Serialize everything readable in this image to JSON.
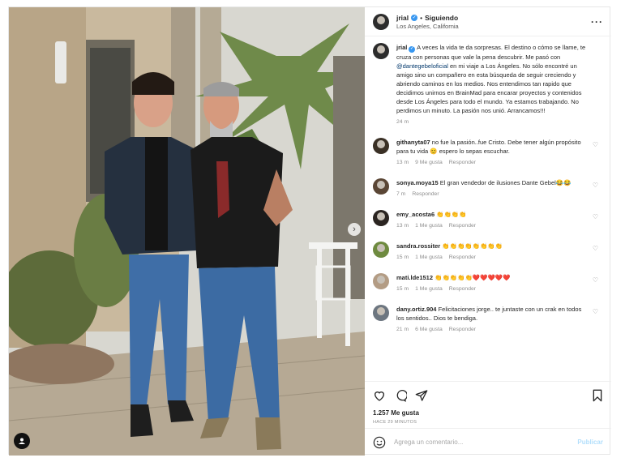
{
  "post": {
    "username": "jrial",
    "follow_label": "Siguiendo",
    "location": "Los Angeles, California",
    "caption_text": "A veces la vida te da sorpresas. El destino o cómo se llame, te cruza con personas que vale la pena descubrir. Me pasó con ",
    "caption_mention": "@dantegebeloficial",
    "caption_text2": " en mi viaje a Los Ángeles. No sólo encontré un amigo sino un compañero en esta búsqueda de seguir creciendo y abriendo caminos en los medios. Nos entendimos tan rapido que decidimos unirnos en BrainMad para encarar proyectos y contenidos desde Los Ángeles para todo el mundo. Ya estamos trabajando. No perdimos un minuto. La pasión nos unió. Arrancamos!!!",
    "caption_time": "24 m"
  },
  "comments": [
    {
      "user": "githanyta07",
      "text": "no fue la pasión..fue Cristo. Debe tener algún propósito para tu vida 😊 espero lo sepas escuchar.",
      "time": "13 m",
      "likes": "9 Me gusta",
      "reply": "Responder"
    },
    {
      "user": "sonya.moya15",
      "text": "El gran vendedor de ilusiones Dante Gebel😂😂",
      "time": "7 m",
      "likes": "",
      "reply": "Responder"
    },
    {
      "user": "emy_acosta6",
      "text": "👏👏👏👏",
      "time": "13 m",
      "likes": "1 Me gusta",
      "reply": "Responder"
    },
    {
      "user": "sandra.rossiter",
      "text": "👏👏👏👏👏👏👏👏",
      "time": "15 m",
      "likes": "1 Me gusta",
      "reply": "Responder"
    },
    {
      "user": "mati.lde1512",
      "text": "👏👏👏👏👏❤️❤️❤️❤️❤️",
      "time": "15 m",
      "likes": "1 Me gusta",
      "reply": "Responder"
    },
    {
      "user": "dany.ortiz.904",
      "text": "Felicitaciones jorge.. te juntaste con un crak en todos los sentidos.. Dios te bendiga.",
      "time": "21 m",
      "likes": "6 Me gusta",
      "reply": "Responder"
    }
  ],
  "footer": {
    "likes": "1.257 Me gusta",
    "time_ago": "HACE 29 MINUTOS",
    "comment_placeholder": "Agrega un comentario...",
    "post_label": "Publicar"
  },
  "icons": {
    "like": "heart-icon",
    "comment": "comment-icon",
    "share": "share-icon",
    "save": "bookmark-icon",
    "more": "more-icon",
    "emoji": "emoji-icon",
    "tag": "user-tag-icon",
    "next": "chevron-right-icon"
  },
  "colors": {
    "verified": "#3897f0",
    "mention": "#00376b",
    "publish": "#b2dffc"
  }
}
